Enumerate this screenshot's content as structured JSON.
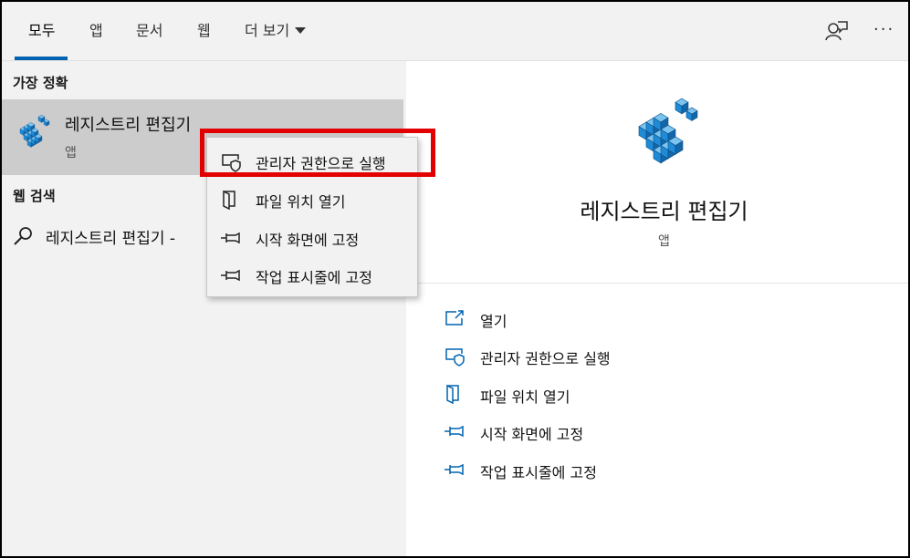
{
  "header": {
    "tabs": [
      {
        "label": "모두"
      },
      {
        "label": "앱"
      },
      {
        "label": "문서"
      },
      {
        "label": "웹"
      },
      {
        "label": "더 보기"
      }
    ],
    "feedback_icon": "feedback-person-icon",
    "more_icon": "more-options-icon",
    "more_label": "···"
  },
  "left": {
    "best_match_title": "가장 정확",
    "best_match": {
      "name": "레지스트리 편집기",
      "type": "앱",
      "icon": "registry-editor-icon"
    },
    "web_title": "웹 검색",
    "web_query": "레지스트리 편집기 -"
  },
  "context_menu": {
    "items": [
      {
        "label": "관리자 권한으로 실행",
        "icon": "shield-run-icon"
      },
      {
        "label": "파일 위치 열기",
        "icon": "file-location-icon"
      },
      {
        "label": "시작 화면에 고정",
        "icon": "pin-icon"
      },
      {
        "label": "작업 표시줄에 고정",
        "icon": "pin-icon"
      }
    ]
  },
  "right": {
    "name": "레지스트리 편집기",
    "type": "앱",
    "actions": [
      {
        "label": "열기",
        "icon": "open-icon"
      },
      {
        "label": "관리자 권한으로 실행",
        "icon": "shield-run-icon"
      },
      {
        "label": "파일 위치 열기",
        "icon": "file-location-icon"
      },
      {
        "label": "시작 화면에 고정",
        "icon": "pin-icon"
      },
      {
        "label": "작업 표시줄에 고정",
        "icon": "pin-icon"
      }
    ]
  },
  "colors": {
    "accent": "#0063b1",
    "highlight": "#e30000",
    "icon_blue": "#1f8ad6"
  }
}
